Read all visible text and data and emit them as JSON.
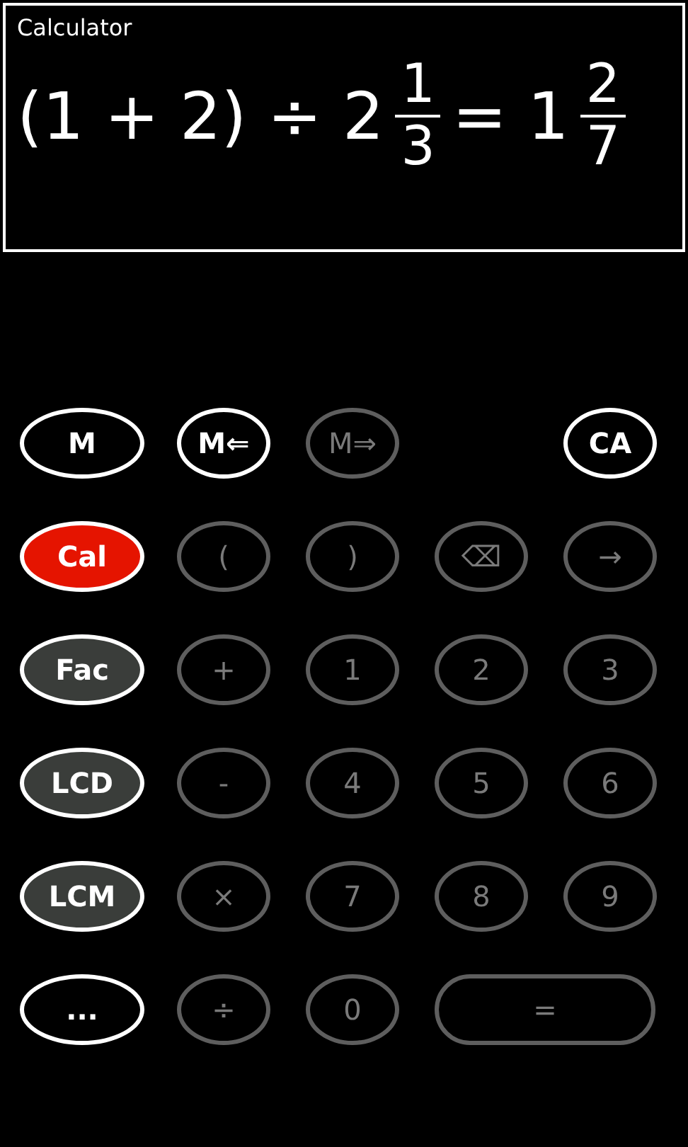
{
  "app_title": "Calculator",
  "expression": [
    {
      "kind": "text",
      "text": "(1 + 2) ÷ 2"
    },
    {
      "kind": "fraction",
      "numerator": "1",
      "denominator": "3"
    },
    {
      "kind": "text",
      "text": "= 1"
    },
    {
      "kind": "fraction",
      "numerator": "2",
      "denominator": "7"
    }
  ],
  "memory_buttons": [
    {
      "label": "M",
      "disabled": false
    },
    {
      "label": "M⇐",
      "disabled": false
    },
    {
      "label": "M⇒",
      "disabled": true
    }
  ],
  "clear_button": {
    "label": "CA",
    "disabled": false
  },
  "mode_buttons": [
    {
      "label": "Cal",
      "kind": "mode",
      "selected": true
    },
    {
      "label": "Fac",
      "kind": "mode",
      "selected": false
    },
    {
      "label": "LCD",
      "kind": "mode",
      "selected": false
    },
    {
      "label": "LCM",
      "kind": "mode",
      "selected": false
    },
    {
      "label": "...",
      "kind": "more",
      "selected": false
    }
  ],
  "keypad": [
    {
      "label": "(",
      "kind": "key",
      "disabled": true
    },
    {
      "label": ")",
      "kind": "key",
      "disabled": true
    },
    {
      "label": "⌫",
      "kind": "key",
      "disabled": true
    },
    {
      "label": "→",
      "kind": "key",
      "disabled": true
    },
    {
      "label": "+",
      "kind": "key",
      "disabled": true
    },
    {
      "label": "1",
      "kind": "key",
      "disabled": true
    },
    {
      "label": "2",
      "kind": "key",
      "disabled": true
    },
    {
      "label": "3",
      "kind": "key",
      "disabled": true
    },
    {
      "label": "-",
      "kind": "key",
      "disabled": true
    },
    {
      "label": "4",
      "kind": "key",
      "disabled": true
    },
    {
      "label": "5",
      "kind": "key",
      "disabled": true
    },
    {
      "label": "6",
      "kind": "key",
      "disabled": true
    },
    {
      "label": "×",
      "kind": "key",
      "disabled": true
    },
    {
      "label": "7",
      "kind": "key",
      "disabled": true
    },
    {
      "label": "8",
      "kind": "key",
      "disabled": true
    },
    {
      "label": "9",
      "kind": "key",
      "disabled": true
    },
    {
      "label": "÷",
      "kind": "key",
      "disabled": true
    },
    {
      "label": "0",
      "kind": "key",
      "disabled": true
    },
    {
      "label": "=",
      "kind": "wide",
      "disabled": true
    }
  ]
}
